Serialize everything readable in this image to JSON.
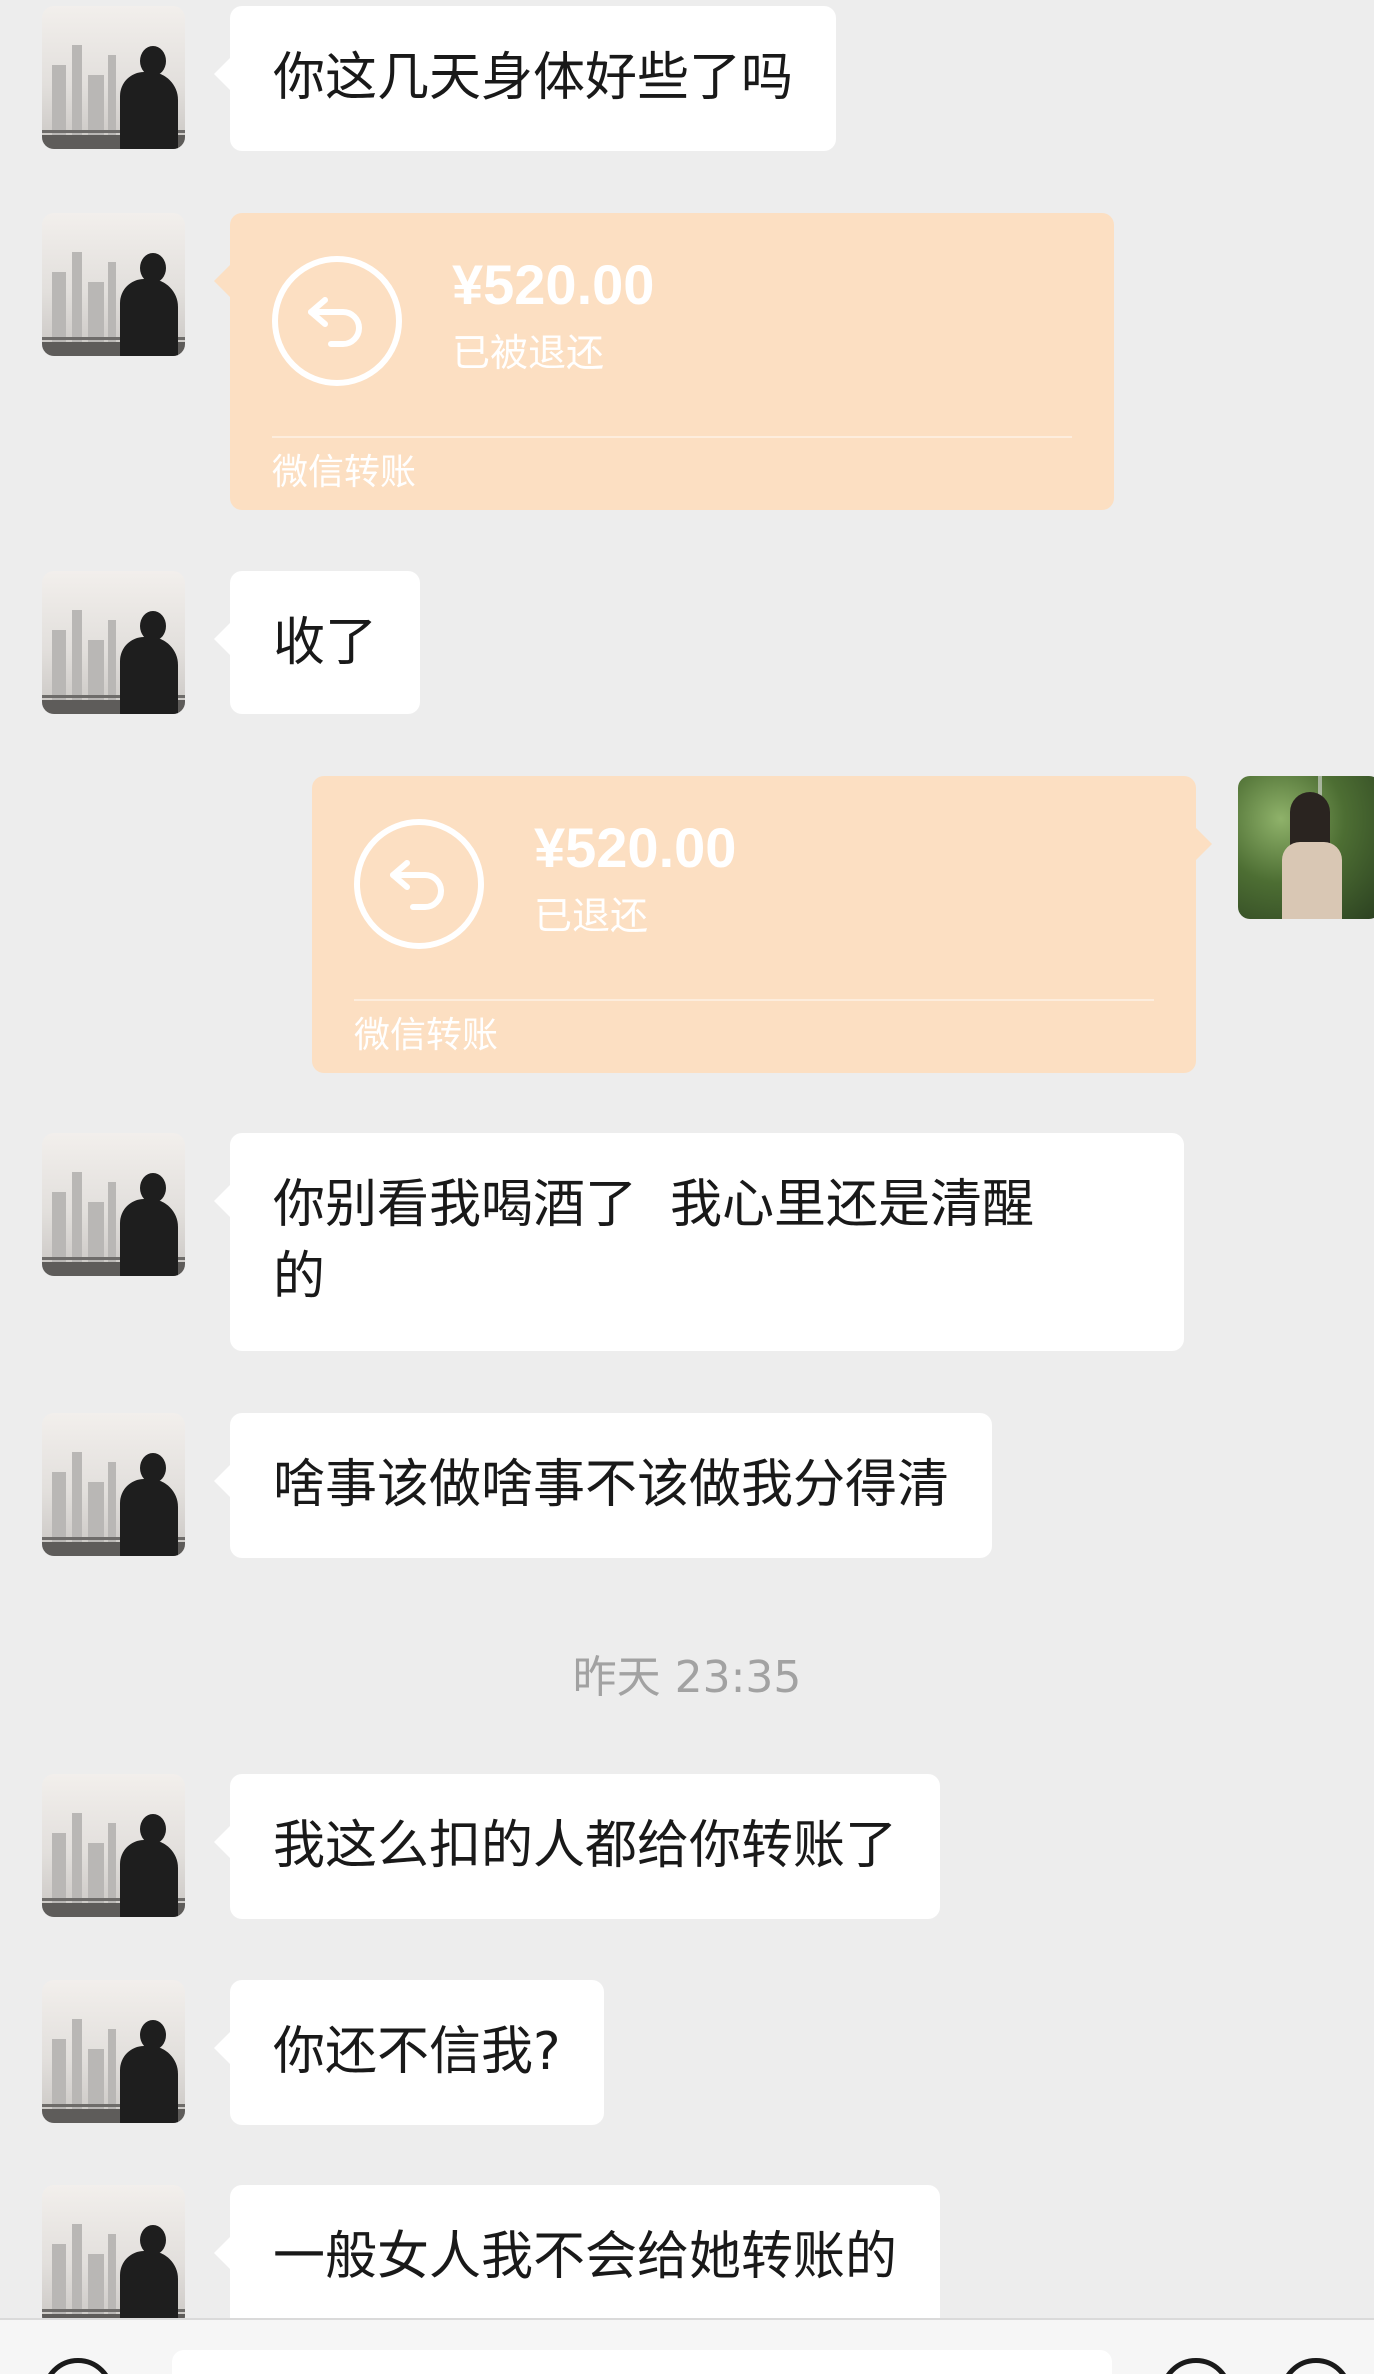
{
  "messages": [
    {
      "text": "你这几天身体好些了吗"
    },
    {
      "transfer_amount": "¥520.00",
      "transfer_status": "已被退还",
      "transfer_footer": "微信转账"
    },
    {
      "text": "收了"
    },
    {
      "transfer_amount": "¥520.00",
      "transfer_status": "已退还",
      "transfer_footer": "微信转账"
    },
    {
      "text_line1": "你别看我喝酒了  我心里还是清醒",
      "text_line2": "的"
    },
    {
      "text": "啥事该做啥事不该做我分得清"
    },
    {
      "text": "我这么扣的人都给你转账了"
    },
    {
      "text": "你还不信我?"
    },
    {
      "text": "一般女人我不会给她转账的"
    }
  ],
  "timestamp": "昨天 23:35",
  "icons": {
    "refund": "refund-arrow-icon",
    "voice": "voice-icon",
    "emoji": "emoji-icon",
    "plus": "plus-icon"
  },
  "colors": {
    "background": "#ededed",
    "bubble": "#ffffff",
    "transfer_card": "#fcdfc2",
    "timestamp_text": "#a2a2a2"
  }
}
